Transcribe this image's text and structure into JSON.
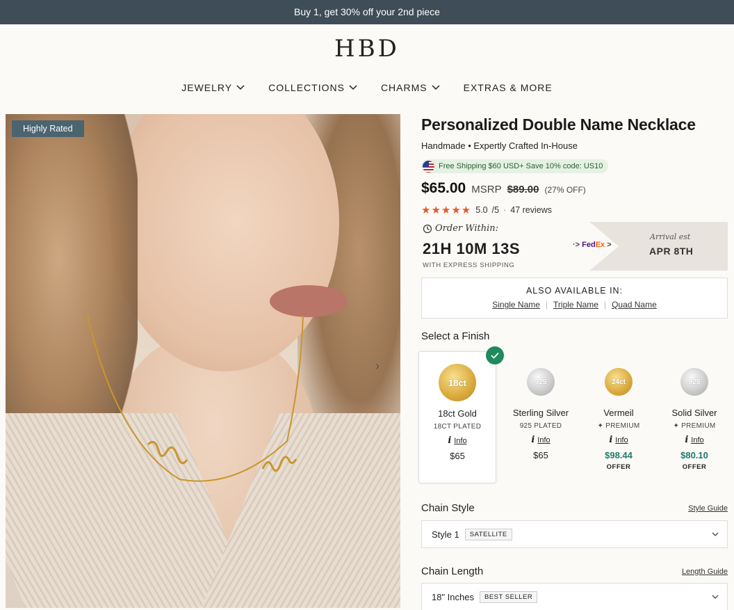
{
  "promo": {
    "text": "Buy 1, get 30% off your 2nd piece"
  },
  "brand": {
    "logo": "HBD"
  },
  "nav": [
    {
      "label": "JEWELRY",
      "has_dropdown": true
    },
    {
      "label": "COLLECTIONS",
      "has_dropdown": true
    },
    {
      "label": "CHARMS",
      "has_dropdown": true
    },
    {
      "label": "EXTRAS & MORE",
      "has_dropdown": false
    }
  ],
  "gallery": {
    "badge": "Highly Rated"
  },
  "product": {
    "title": "Personalized Double Name Necklace",
    "subtitle": "Handmade • Expertly Crafted In-House",
    "shipping_promo": "Free Shipping $60 USD+ Save 10% code: US10",
    "price": "$65.00",
    "msrp_label": "MSRP",
    "msrp_price": "$89.00",
    "discount": "(27% OFF)",
    "rating": "5.0",
    "rating_max": "/5",
    "reviews": "47 reviews",
    "star_count": 5
  },
  "order": {
    "label": "Order Within:",
    "countdown": "21H 10M 13S",
    "express": "WITH EXPRESS SHIPPING",
    "carrier_fe": "Fed",
    "carrier_ex": "Ex",
    "arrival_label": "Arrival est",
    "arrival_date": "APR 8TH"
  },
  "also_available": {
    "title": "ALSO AVAILABLE IN:",
    "links": [
      "Single Name",
      "Triple Name",
      "Quad Name"
    ]
  },
  "finish": {
    "label": "Select a Finish",
    "options": [
      {
        "coin": "18ct",
        "name": "18ct Gold",
        "sub": "18CT PLATED",
        "info": "Info",
        "price": "$65",
        "offer": "",
        "metal": "gold",
        "selected": true,
        "premium": false
      },
      {
        "coin": "925",
        "name": "Sterling Silver",
        "sub": "925 PLATED",
        "info": "Info",
        "price": "$65",
        "offer": "",
        "metal": "silver",
        "selected": false,
        "premium": false
      },
      {
        "coin": "24ct",
        "name": "Vermeil",
        "sub": "PREMIUM",
        "info": "Info",
        "price": "$98.44",
        "offer": "OFFER",
        "metal": "gold",
        "selected": false,
        "premium": true
      },
      {
        "coin": "925",
        "name": "Solid Silver",
        "sub": "PREMIUM",
        "info": "Info",
        "price": "$80.10",
        "offer": "OFFER",
        "metal": "silver",
        "selected": false,
        "premium": true
      }
    ]
  },
  "chain_style": {
    "label": "Chain Style",
    "guide": "Style Guide",
    "value": "Style 1",
    "tag": "SATELLITE"
  },
  "chain_length": {
    "label": "Chain Length",
    "guide": "Length Guide",
    "value": "18\" Inches",
    "tag": "BEST SELLER"
  },
  "colors": {
    "promo_bg": "#3e4d57",
    "badge_bg": "#4a6470",
    "star": "#e5592b",
    "offer_price": "#1e7a6b",
    "check": "#1f8a5b",
    "pill_bg": "#e4f1e3"
  }
}
